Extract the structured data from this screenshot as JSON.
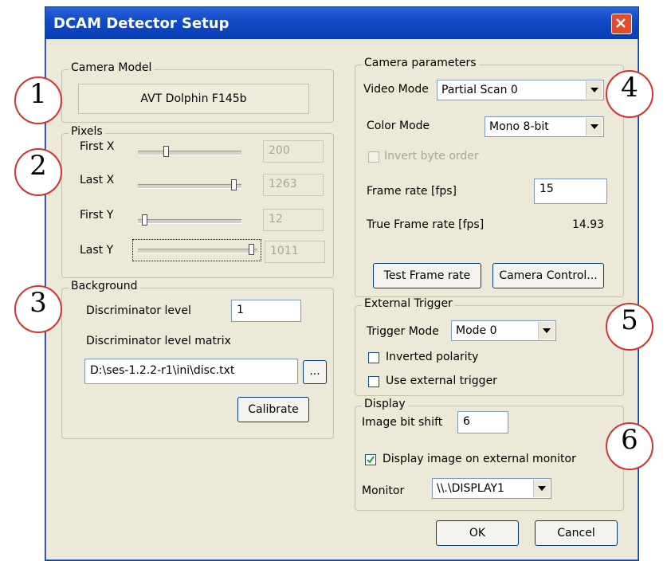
{
  "dialog": {
    "title": "DCAM Detector Setup",
    "close_icon": "close-icon",
    "accent_color": "#0f49c5",
    "close_color": "#e34b2a"
  },
  "camera_model": {
    "legend": "Camera Model",
    "value": "AVT Dolphin F145b"
  },
  "pixels": {
    "legend": "Pixels",
    "rows": [
      {
        "label": "First X",
        "value": "200",
        "slider_fraction": 0.25
      },
      {
        "label": "Last X",
        "value": "1263",
        "slider_fraction": 0.9
      },
      {
        "label": "First Y",
        "value": "12",
        "slider_fraction": 0.05
      },
      {
        "label": "Last Y",
        "value": "1011",
        "slider_fraction": 0.95
      }
    ]
  },
  "background": {
    "legend": "Background",
    "disc_level_label": "Discriminator level",
    "disc_level_value": "1",
    "disc_matrix_label": "Discriminator level matrix",
    "disc_matrix_path": "D:\\ses-1.2.2-r1\\ini\\disc.txt",
    "browse_label": "...",
    "calibrate_label": "Calibrate"
  },
  "camera_params": {
    "legend": "Camera parameters",
    "video_mode_label": "Video Mode",
    "video_mode_value": "Partial Scan 0",
    "color_mode_label": "Color Mode",
    "color_mode_value": "Mono 8-bit",
    "invert_byte_label": "Invert byte order",
    "frame_rate_label": "Frame rate [fps]",
    "frame_rate_value": "15",
    "true_frame_rate_label": "True Frame rate [fps]",
    "true_frame_rate_value": "14.93",
    "test_frame_rate_label": "Test Frame rate",
    "camera_control_label": "Camera Control..."
  },
  "external_trigger": {
    "legend": "External Trigger",
    "trigger_mode_label": "Trigger Mode",
    "trigger_mode_value": "Mode 0",
    "inverted_polarity_label": "Inverted polarity",
    "inverted_polarity_checked": false,
    "use_external_label": "Use external trigger",
    "use_external_checked": false
  },
  "display": {
    "legend": "Display",
    "bit_shift_label": "Image bit shift",
    "bit_shift_value": "6",
    "display_external_label": "Display image on external monitor",
    "display_external_checked": true,
    "monitor_label": "Monitor",
    "monitor_value": "\\\\.\\DISPLAY1"
  },
  "footer": {
    "ok_label": "OK",
    "cancel_label": "Cancel"
  },
  "callouts": [
    "1",
    "2",
    "3",
    "4",
    "5",
    "6"
  ],
  "callout_color": "#d13232"
}
